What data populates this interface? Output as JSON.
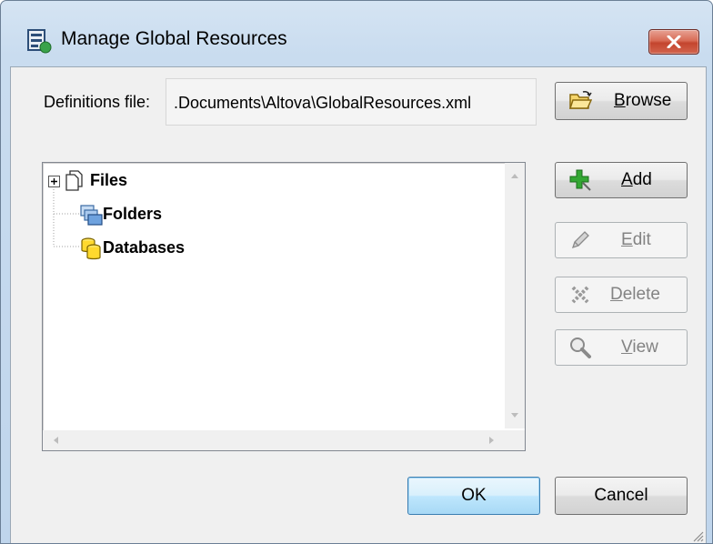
{
  "window": {
    "title": "Manage Global Resources",
    "icon": "global-resources-app-icon"
  },
  "definitions": {
    "label": "Definitions file:",
    "value": ".Documents\\Altova\\GlobalResources.xml"
  },
  "buttons": {
    "browse": "Browse",
    "add": "Add",
    "edit": "Edit",
    "delete": "Delete",
    "view": "View",
    "ok": "OK",
    "cancel": "Cancel"
  },
  "tree": {
    "items": [
      {
        "label": "Files",
        "icon": "files-icon",
        "expandable": true
      },
      {
        "label": "Folders",
        "icon": "folders-icon",
        "expandable": false
      },
      {
        "label": "Databases",
        "icon": "databases-icon",
        "expandable": false
      }
    ]
  },
  "colors": {
    "close_button": "#c94a33",
    "add_icon": "#2e9a2e"
  }
}
